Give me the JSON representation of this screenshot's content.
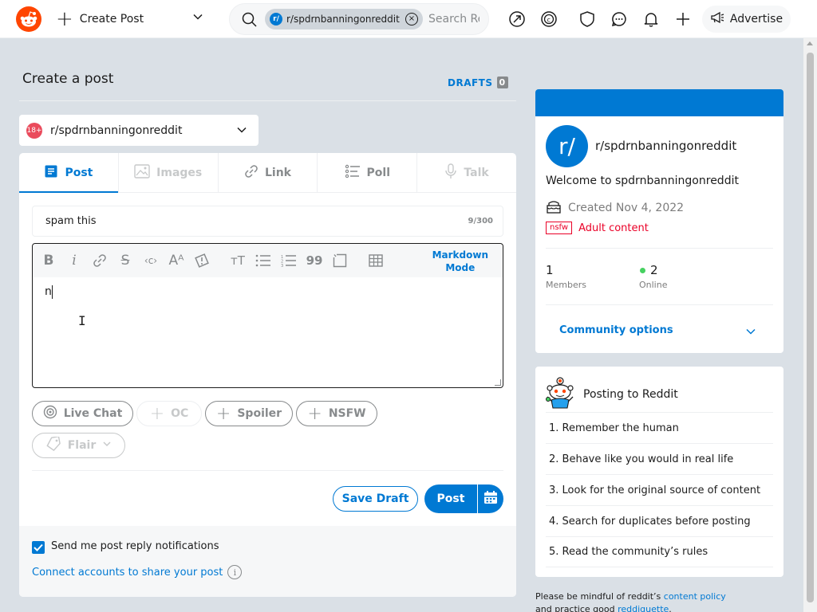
{
  "header": {
    "create_label": "Create Post",
    "search_chip": "r/spdrnbanningonreddit",
    "search_placeholder": "Search Reddit",
    "advertise_label": "Advertise"
  },
  "page": {
    "title": "Create a post",
    "drafts_label": "DRAFTS",
    "drafts_count": "0"
  },
  "community_selector": {
    "badge": "18+",
    "name": "r/spdrnbanningonreddit"
  },
  "tabs": [
    {
      "label": "Post",
      "state": "active"
    },
    {
      "label": "Images",
      "state": "disabled"
    },
    {
      "label": "Link",
      "state": "normal"
    },
    {
      "label": "Poll",
      "state": "normal"
    },
    {
      "label": "Talk",
      "state": "disabled"
    }
  ],
  "post_title": {
    "value": "spam this",
    "counter": "9/300"
  },
  "editor": {
    "markdown_mode_line1": "Markdown",
    "markdown_mode_line2": "Mode",
    "body_text": "n"
  },
  "tags": {
    "live_chat": "Live Chat",
    "oc": "OC",
    "spoiler": "Spoiler",
    "nsfw": "NSFW",
    "flair": "Flair"
  },
  "actions": {
    "save_draft": "Save Draft",
    "post": "Post"
  },
  "footer_options": {
    "notifications_label": "Send me post reply notifications",
    "notifications_checked": true,
    "connect_label": "Connect accounts to share your post"
  },
  "sidebar": {
    "avatar_text": "r/",
    "name": "r/spdrnbanningonreddit",
    "welcome": "Welcome to spdrnbanningonreddit",
    "created": "Created Nov 4, 2022",
    "nsfw_tag": "nsfw",
    "adult_label": "Adult content",
    "members_count": "1",
    "members_label": "Members",
    "online_count": "2",
    "online_label": "Online",
    "community_options": "Community options",
    "banner_color": "#0079d3"
  },
  "posting_rules": {
    "title": "Posting to Reddit",
    "rules": [
      "1. Remember the human",
      "2. Behave like you would in real life",
      "3. Look for the original source of content",
      "4. Search for duplicates before posting",
      "5. Read the community’s rules"
    ]
  },
  "footer_note": {
    "line1_prefix": "Please be mindful of reddit’s ",
    "line1_link": "content policy",
    "line2_prefix": "and practice good ",
    "line2_link": "reddiquette",
    "line2_suffix": "."
  }
}
